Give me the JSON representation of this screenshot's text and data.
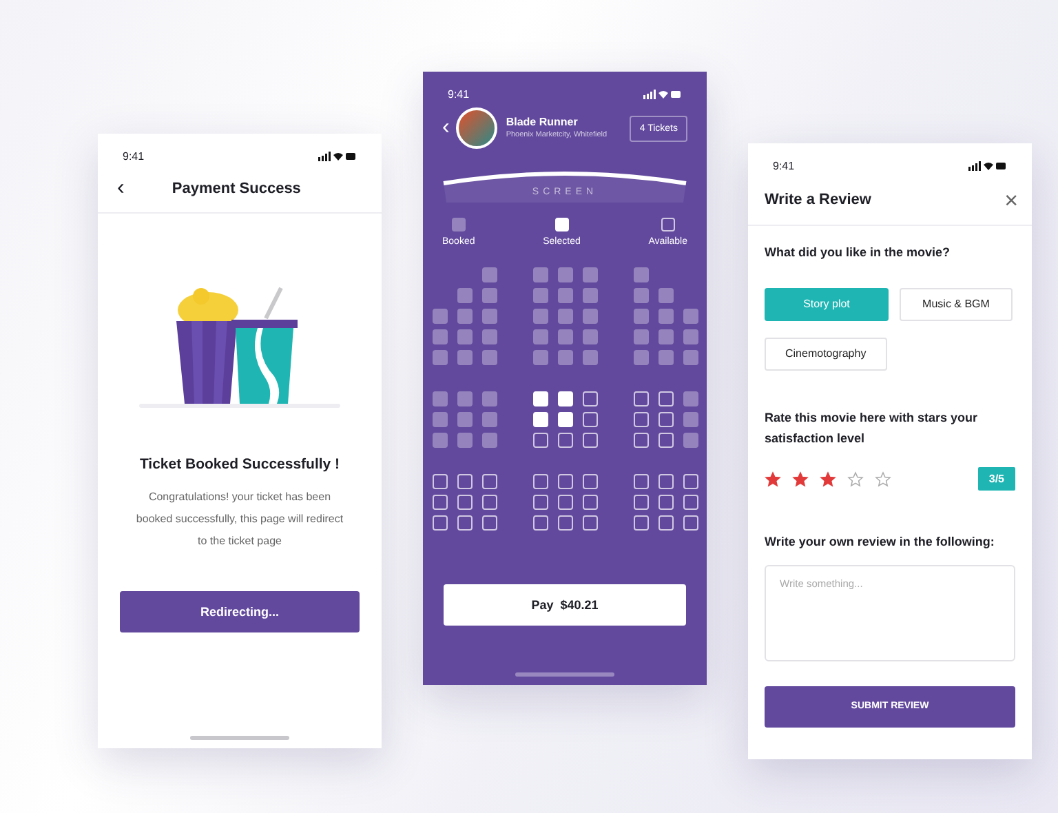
{
  "payment_screen": {
    "status_time": "9:41",
    "back": "‹",
    "title": "Payment Success",
    "heading": "Ticket Booked Successfully !",
    "message": "Congratulations! your ticket has been booked successfully, this page will redirect to the ticket page",
    "button": "Redirecting..."
  },
  "booking_screen": {
    "status_time": "9:41",
    "back": "‹",
    "movie_title": "Blade Runner",
    "venue": "Phoenix Marketcity, Whitefield",
    "tickets": "4 Tickets",
    "screen_label": "SCREEN",
    "legend": [
      {
        "kind": "booked",
        "label": "Booked"
      },
      {
        "kind": "selected",
        "label": "Selected"
      },
      {
        "kind": "available",
        "label": "Available"
      }
    ],
    "seat_blocks": [
      {
        "rows": [
          [
            {
              "kind": "gap"
            },
            {
              "kind": "gap"
            },
            {
              "kind": "booked"
            },
            {
              "kind": "booked"
            },
            {
              "kind": "booked"
            },
            {
              "kind": "booked"
            },
            {
              "kind": "booked"
            },
            {
              "kind": "gap"
            },
            {
              "kind": "gap"
            }
          ],
          [
            {
              "kind": "gap"
            },
            {
              "kind": "booked"
            },
            {
              "kind": "booked"
            },
            {
              "kind": "booked"
            },
            {
              "kind": "booked"
            },
            {
              "kind": "booked"
            },
            {
              "kind": "booked"
            },
            {
              "kind": "booked"
            },
            {
              "kind": "gap"
            }
          ],
          [
            {
              "kind": "booked"
            },
            {
              "kind": "booked"
            },
            {
              "kind": "booked"
            },
            {
              "kind": "booked"
            },
            {
              "kind": "booked"
            },
            {
              "kind": "booked"
            },
            {
              "kind": "booked"
            },
            {
              "kind": "booked"
            },
            {
              "kind": "booked"
            }
          ],
          [
            {
              "kind": "booked"
            },
            {
              "kind": "booked"
            },
            {
              "kind": "booked"
            },
            {
              "kind": "booked"
            },
            {
              "kind": "booked"
            },
            {
              "kind": "booked"
            },
            {
              "kind": "booked"
            },
            {
              "kind": "booked"
            },
            {
              "kind": "booked"
            }
          ],
          [
            {
              "kind": "booked"
            },
            {
              "kind": "booked"
            },
            {
              "kind": "booked"
            },
            {
              "kind": "booked"
            },
            {
              "kind": "booked"
            },
            {
              "kind": "booked"
            },
            {
              "kind": "booked"
            },
            {
              "kind": "booked"
            },
            {
              "kind": "booked"
            }
          ]
        ]
      },
      {
        "rows": [
          [
            {
              "kind": "booked"
            },
            {
              "kind": "booked"
            },
            {
              "kind": "booked"
            },
            {
              "kind": "selected"
            },
            {
              "kind": "selected"
            },
            {
              "kind": "available"
            },
            {
              "kind": "available"
            },
            {
              "kind": "available"
            },
            {
              "kind": "booked"
            }
          ],
          [
            {
              "kind": "booked"
            },
            {
              "kind": "booked"
            },
            {
              "kind": "booked"
            },
            {
              "kind": "selected"
            },
            {
              "kind": "selected"
            },
            {
              "kind": "available"
            },
            {
              "kind": "available"
            },
            {
              "kind": "available"
            },
            {
              "kind": "booked"
            }
          ],
          [
            {
              "kind": "booked"
            },
            {
              "kind": "booked"
            },
            {
              "kind": "booked"
            },
            {
              "kind": "available"
            },
            {
              "kind": "available"
            },
            {
              "kind": "available"
            },
            {
              "kind": "available"
            },
            {
              "kind": "available"
            },
            {
              "kind": "booked"
            }
          ]
        ]
      },
      {
        "rows": [
          [
            {
              "kind": "available"
            },
            {
              "kind": "available"
            },
            {
              "kind": "available"
            },
            {
              "kind": "available"
            },
            {
              "kind": "available"
            },
            {
              "kind": "available"
            },
            {
              "kind": "available"
            },
            {
              "kind": "available"
            },
            {
              "kind": "available"
            }
          ],
          [
            {
              "kind": "available"
            },
            {
              "kind": "available"
            },
            {
              "kind": "available"
            },
            {
              "kind": "available"
            },
            {
              "kind": "available"
            },
            {
              "kind": "available"
            },
            {
              "kind": "available"
            },
            {
              "kind": "available"
            },
            {
              "kind": "available"
            }
          ],
          [
            {
              "kind": "available"
            },
            {
              "kind": "available"
            },
            {
              "kind": "available"
            },
            {
              "kind": "available"
            },
            {
              "kind": "available"
            },
            {
              "kind": "available"
            },
            {
              "kind": "available"
            },
            {
              "kind": "available"
            },
            {
              "kind": "available"
            }
          ]
        ]
      }
    ],
    "pay_button": "Pay  $40.21"
  },
  "review_screen": {
    "status_time": "9:41",
    "title": "Write a Review",
    "close": "×",
    "question": "What did you like in the movie?",
    "tags": [
      {
        "label": "Story plot",
        "selected": true
      },
      {
        "label": "Music & BGM",
        "selected": false
      },
      {
        "label": "Cinemotography",
        "selected": false
      }
    ],
    "rating_prompt": "Rate this movie here with stars your satisfaction level",
    "stars": 3,
    "rating_badge": "3/5",
    "review_label": "Write your own review in the following:",
    "review_placeholder": "Write something...",
    "submit": "SUBMIT REVIEW"
  }
}
